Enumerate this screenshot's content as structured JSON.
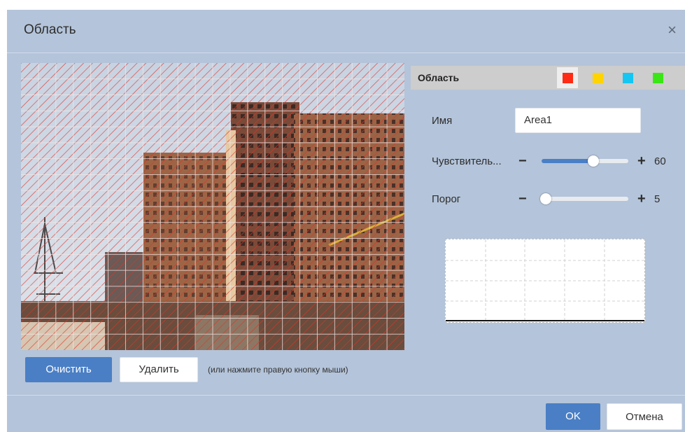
{
  "dialog": {
    "title": "Область",
    "close_glyph": "×"
  },
  "preview": {
    "image_description_icon": "camera-preview",
    "grid": {
      "columns": 22,
      "rows": 18
    },
    "overlay_color": "#e0342b"
  },
  "actions": {
    "clear_label": "Очистить",
    "delete_label": "Удалить",
    "hint": "(или нажмите правую кнопку мыши)"
  },
  "area_panel": {
    "header_label": "Область",
    "colors": [
      {
        "name": "red",
        "hex": "#ff2b14",
        "selected": true
      },
      {
        "name": "yellow",
        "hex": "#ffd400",
        "selected": false
      },
      {
        "name": "cyan",
        "hex": "#15c6f2",
        "selected": false
      },
      {
        "name": "green",
        "hex": "#3ae615",
        "selected": false
      }
    ],
    "name_label": "Имя",
    "name_value": "Area1",
    "sensitivity_label": "Чувствитель...",
    "sensitivity_value": "60",
    "sensitivity_level": 0.6,
    "threshold_label": "Порог",
    "threshold_value": "5",
    "threshold_level": 0.05,
    "minus_glyph": "−",
    "plus_glyph": "+"
  },
  "footer": {
    "ok_label": "OK",
    "cancel_label": "Отмена"
  },
  "colors": {
    "accent": "#4a7fc5",
    "dialog_bg": "#b4c4da"
  }
}
